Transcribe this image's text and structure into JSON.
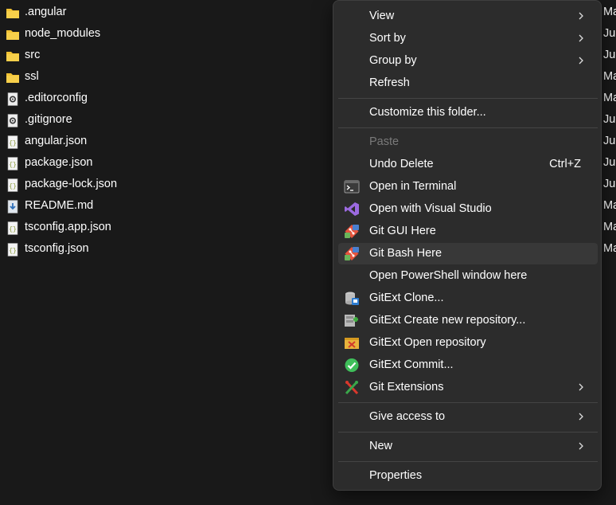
{
  "files": [
    {
      "name": ".angular",
      "icon": "folder-icon",
      "date": "Ma"
    },
    {
      "name": "node_modules",
      "icon": "folder-icon",
      "date": "Jun"
    },
    {
      "name": "src",
      "icon": "folder-icon",
      "date": "Jun"
    },
    {
      "name": "ssl",
      "icon": "folder-icon",
      "date": "Ma"
    },
    {
      "name": ".editorconfig",
      "icon": "settings-file-icon",
      "date": "Ma"
    },
    {
      "name": ".gitignore",
      "icon": "settings-file-icon",
      "date": "Jun"
    },
    {
      "name": "angular.json",
      "icon": "json-file-icon",
      "date": "Jun"
    },
    {
      "name": "package.json",
      "icon": "json-file-icon",
      "date": "Jun"
    },
    {
      "name": "package-lock.json",
      "icon": "json-file-icon",
      "date": "Jun"
    },
    {
      "name": "README.md",
      "icon": "markdown-file-icon",
      "date": "Ma"
    },
    {
      "name": "tsconfig.app.json",
      "icon": "json-file-icon",
      "date": "Ma"
    },
    {
      "name": "tsconfig.json",
      "icon": "json-file-icon",
      "date": "Ma"
    }
  ],
  "menu": {
    "view": "View",
    "sort_by": "Sort by",
    "group_by": "Group by",
    "refresh": "Refresh",
    "customize": "Customize this folder...",
    "paste": "Paste",
    "undo_delete": "Undo Delete",
    "undo_shortcut": "Ctrl+Z",
    "open_terminal": "Open in Terminal",
    "open_vs": "Open with Visual Studio",
    "git_gui": "Git GUI Here",
    "git_bash": "Git Bash Here",
    "open_powershell": "Open PowerShell window here",
    "gitext_clone": "GitExt Clone...",
    "gitext_create": "GitExt Create new repository...",
    "gitext_open": "GitExt Open repository",
    "gitext_commit": "GitExt Commit...",
    "git_extensions": "Git Extensions",
    "give_access": "Give access to",
    "new": "New",
    "properties": "Properties"
  },
  "colors": {
    "background": "#191919",
    "menu_background": "#2c2c2c",
    "hover": "#383838",
    "folder": "#f2c233",
    "vs_purple": "#9c6ae0",
    "git_orange": "#e5533d"
  }
}
